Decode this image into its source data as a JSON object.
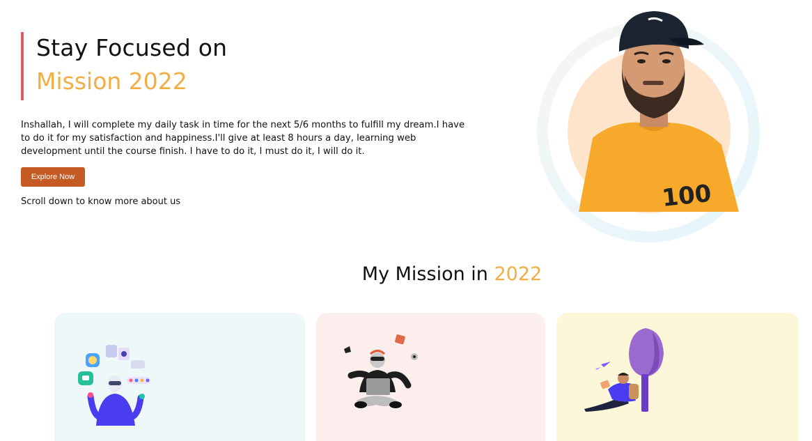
{
  "hero": {
    "title_line1": "Stay Focused on",
    "title_line2": "Mission 2022",
    "paragraph": "Inshallah, I will complete my daily task in time for the next 5/6 months to fulfill my dream.I have to do it for my satisfaction and happiness.I'll give at least 8 hours a day, learning web development until the course finish. I have to do it, I must do it, I will do it.",
    "button_label": "Explore Now",
    "scroll_text": "Scroll down to know more about us"
  },
  "profile": {
    "shirt_text": "100"
  },
  "mission": {
    "heading_prefix": "My Mission in ",
    "heading_year": "2022"
  },
  "cards": [
    {
      "illustration": "person-juggling-apps-illustration",
      "bg": "#eef8f8"
    },
    {
      "illustration": "person-with-laptop-illustration",
      "bg": "#fdeeee"
    },
    {
      "illustration": "person-reading-under-tree-illustration",
      "bg": "#fdf7da"
    }
  ],
  "colors": {
    "accent": "#f1ae45",
    "title_bar": "#e0596b",
    "button": "#c55a22"
  }
}
